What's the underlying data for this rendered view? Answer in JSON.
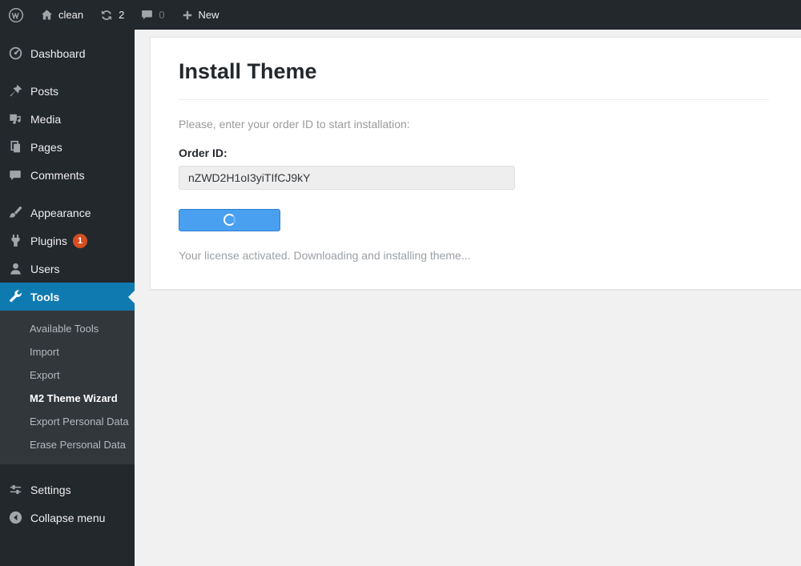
{
  "admin_bar": {
    "site_name": "clean",
    "update_count": "2",
    "comment_count": "0",
    "new_label": "New"
  },
  "sidebar": {
    "items": [
      {
        "label": "Dashboard"
      },
      {
        "label": "Posts"
      },
      {
        "label": "Media"
      },
      {
        "label": "Pages"
      },
      {
        "label": "Comments"
      },
      {
        "label": "Appearance"
      },
      {
        "label": "Plugins"
      },
      {
        "label": "Users"
      },
      {
        "label": "Tools"
      }
    ],
    "plugins_badge": "1",
    "tools_submenu": [
      "Available Tools",
      "Import",
      "Export",
      "M2 Theme Wizard",
      "Export Personal Data",
      "Erase Personal Data"
    ],
    "settings_label": "Settings",
    "collapse_label": "Collapse menu"
  },
  "main": {
    "title": "Install Theme",
    "instruction": "Please, enter your order ID to start installation:",
    "order_id_label": "Order ID:",
    "order_id_value": "nZWD2H1oI3yiTIfCJ9kY",
    "status_message": "Your license activated. Downloading and installing theme..."
  },
  "colors": {
    "admin_bar_bg": "#23282d",
    "submenu_bg": "#32373c",
    "active_menu_blue": "#0f7ab0",
    "button_blue": "#49a0f0",
    "badge_red": "#d54e21",
    "content_bg": "#f1f1f1"
  }
}
